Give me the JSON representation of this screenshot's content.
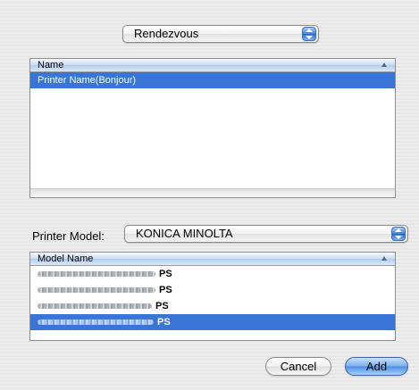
{
  "top_popup": {
    "value": "Rendezvous"
  },
  "printer_list": {
    "header": "Name",
    "rows": [
      {
        "name": "Printer Name(Bonjour)",
        "selected": true
      }
    ]
  },
  "printer_model": {
    "label": "Printer Model:",
    "value": "KONICA MINOLTA"
  },
  "model_list": {
    "header": "Model Name",
    "rows": [
      {
        "suffix": "PS",
        "selected": false
      },
      {
        "suffix": "PS",
        "selected": false
      },
      {
        "suffix": "PS",
        "selected": false
      },
      {
        "suffix": "PS",
        "selected": true
      }
    ]
  },
  "buttons": {
    "cancel": "Cancel",
    "add": "Add"
  },
  "colors": {
    "selection": "#3875d7",
    "accent": "#4d90e5"
  },
  "icons": {
    "popup_arrows": "up-down-arrows-icon",
    "sort": "sort-ascending-icon"
  }
}
